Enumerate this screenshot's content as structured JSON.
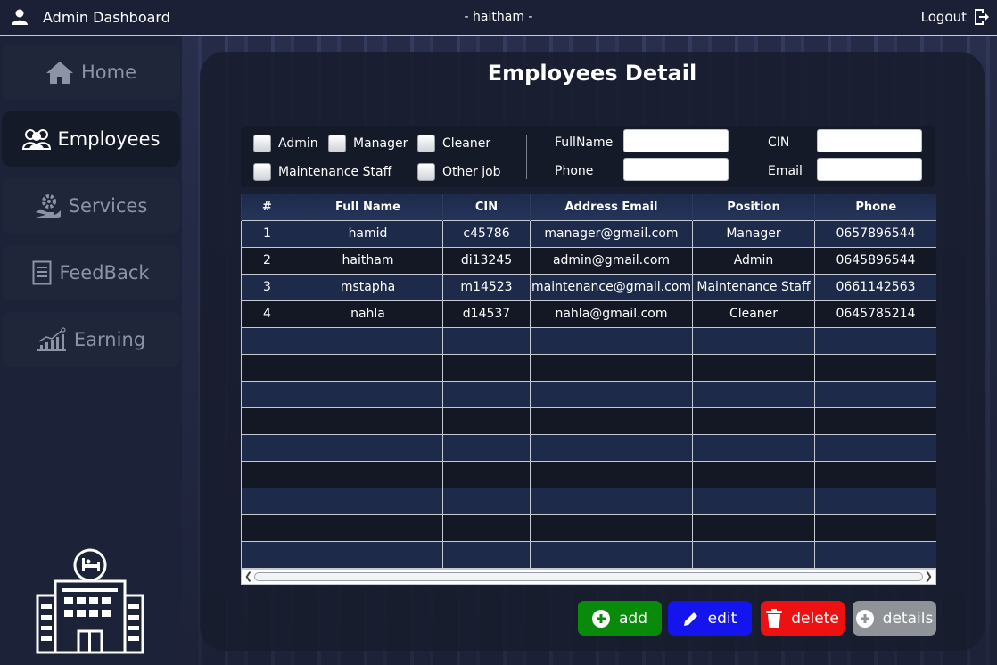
{
  "header": {
    "title": "Admin Dashboard",
    "user": "- haitham -",
    "logout": "Logout"
  },
  "sidebar": {
    "items": [
      {
        "label": "Home",
        "icon": "home-icon",
        "active": false
      },
      {
        "label": "Employees",
        "icon": "users-icon",
        "active": true
      },
      {
        "label": "Services",
        "icon": "services-icon",
        "active": false
      },
      {
        "label": "FeedBack",
        "icon": "document-icon",
        "active": false
      },
      {
        "label": "Earning",
        "icon": "chart-icon",
        "active": false
      }
    ]
  },
  "main": {
    "title": "Employees Detail",
    "filters": {
      "checkboxes": [
        "Admin",
        "Manager",
        "Cleaner",
        "Maintenance Staff",
        "Other job"
      ],
      "fields": {
        "fullname": {
          "label": "FullName",
          "value": ""
        },
        "phone": {
          "label": "Phone",
          "value": ""
        },
        "cin": {
          "label": "CIN",
          "value": ""
        },
        "email": {
          "label": "Email",
          "value": ""
        }
      }
    },
    "table": {
      "columns": [
        "#",
        "Full Name",
        "CIN",
        "Address Email",
        "Position",
        "Phone"
      ],
      "rows": [
        [
          "1",
          "hamid",
          "c45786",
          "manager@gmail.com",
          "Manager",
          "0657896544"
        ],
        [
          "2",
          "haitham",
          "di13245",
          "admin@gmail.com",
          "Admin",
          "0645896544"
        ],
        [
          "3",
          "mstapha",
          "m14523",
          "maintenance@gmail.com",
          "Maintenance Staff",
          "0661142563"
        ],
        [
          "4",
          "nahla",
          "d14537",
          "nahla@gmail.com",
          "Cleaner",
          "0645785214"
        ]
      ]
    },
    "actions": {
      "add": "add",
      "edit": "edit",
      "delete": "delete",
      "details": "details"
    }
  },
  "colors": {
    "add": "#0a8a0a",
    "edit": "#1414ee",
    "delete": "#ee1111",
    "details": "#8f9296"
  }
}
